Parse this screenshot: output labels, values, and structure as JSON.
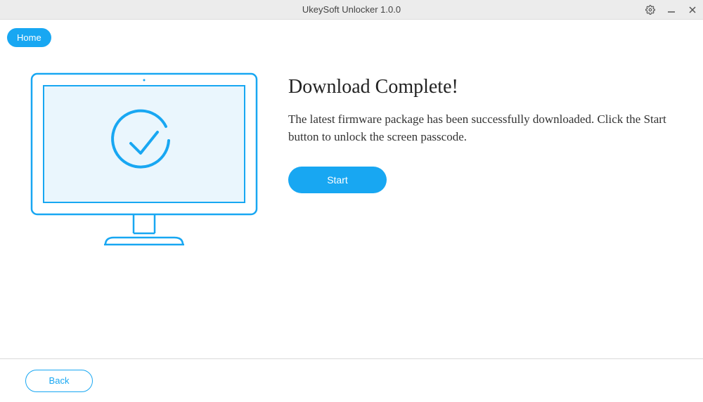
{
  "window": {
    "title": "UkeySoft Unlocker 1.0.0"
  },
  "tabs": {
    "home": "Home"
  },
  "main": {
    "heading": "Download Complete!",
    "description": "The latest firmware package has been successfully downloaded. Click the Start button to unlock the screen passcode.",
    "start_label": "Start"
  },
  "footer": {
    "back_label": "Back"
  },
  "colors": {
    "accent": "#18a7f2"
  }
}
